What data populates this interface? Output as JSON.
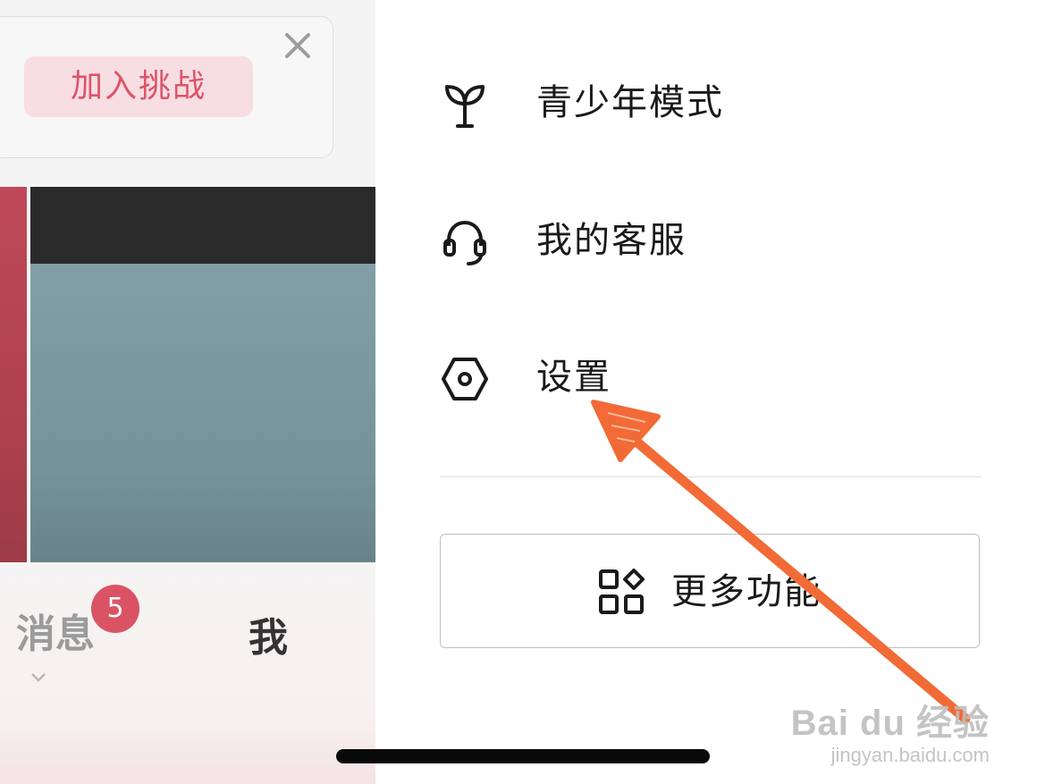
{
  "background_app": {
    "challenge_card": {
      "join_label": "加入挑战"
    },
    "tabbar": {
      "messages_label": "消息",
      "messages_badge": "5",
      "me_label": "我"
    }
  },
  "drawer": {
    "menu": [
      {
        "label": "青少年模式",
        "icon": "sprout-icon"
      },
      {
        "label": "我的客服",
        "icon": "headset-icon"
      },
      {
        "label": "设置",
        "icon": "hexagon-settings-icon"
      }
    ],
    "more_button": {
      "label": "更多功能",
      "icon": "apps-grid-icon"
    }
  },
  "watermark": {
    "brand": "Bai du 经验",
    "url": "jingyan.baidu.com"
  },
  "colors": {
    "annotation_arrow": "#f26a36",
    "badge": "#d4354b",
    "join_button_text": "#d9354f"
  }
}
